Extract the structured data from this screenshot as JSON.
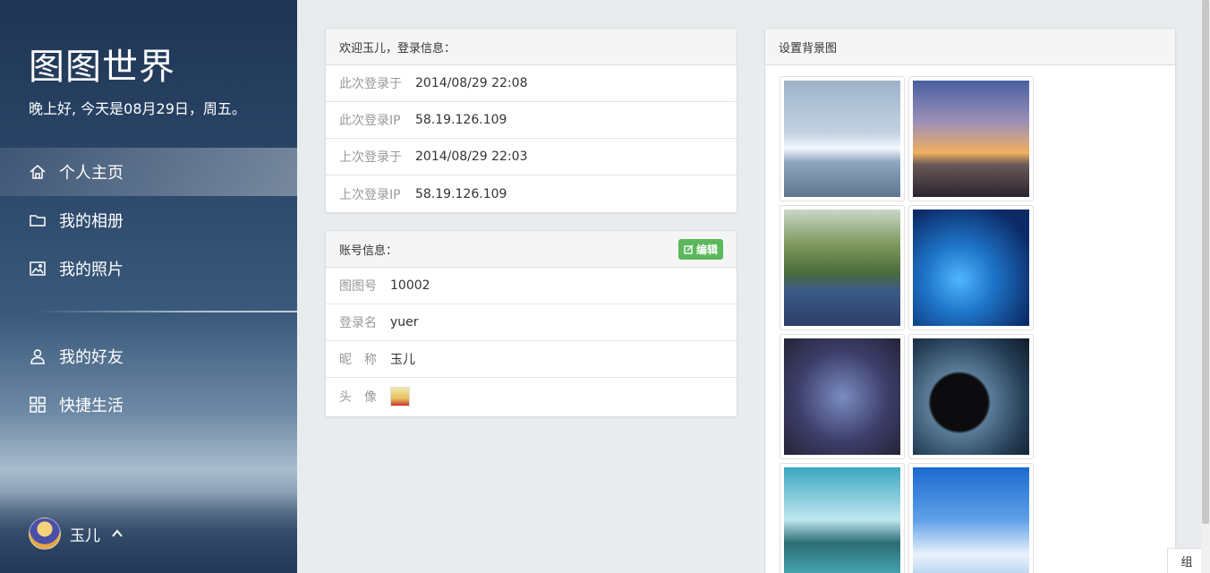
{
  "sidebar": {
    "brand": "图图世界",
    "greeting": "晚上好, 今天是08月29日，周五。",
    "nav": [
      {
        "label": "个人主页",
        "icon": "home-icon"
      },
      {
        "label": "我的相册",
        "icon": "folder-icon"
      },
      {
        "label": "我的照片",
        "icon": "image-icon"
      },
      {
        "label": "我的好友",
        "icon": "user-icon"
      },
      {
        "label": "快捷生活",
        "icon": "grid-icon"
      }
    ],
    "user": {
      "name": "玉儿",
      "icon": "chevron-up-icon"
    }
  },
  "login_panel": {
    "title": "欢迎玉儿，登录信息：",
    "rows": [
      {
        "key": "此次登录于",
        "value": "2014/08/29 22:08"
      },
      {
        "key": "此次登录IP",
        "value": "58.19.126.109"
      },
      {
        "key": "上次登录于",
        "value": "2014/08/29 22:03"
      },
      {
        "key": "上次登录IP",
        "value": "58.19.126.109"
      }
    ]
  },
  "account_panel": {
    "title": "账号信息：",
    "edit_label": "编辑",
    "rows": [
      {
        "key": "图图号",
        "value": "10002"
      },
      {
        "key": "登录名",
        "value": "yuer"
      },
      {
        "key": "昵　称",
        "value": "玉儿"
      },
      {
        "key": "头　像",
        "value": ""
      }
    ]
  },
  "background_panel": {
    "title": "设置背景图"
  },
  "group_tab": "组",
  "colors": {
    "accent_green": "#5cb85c",
    "sidebar_top": "#1f3553"
  }
}
